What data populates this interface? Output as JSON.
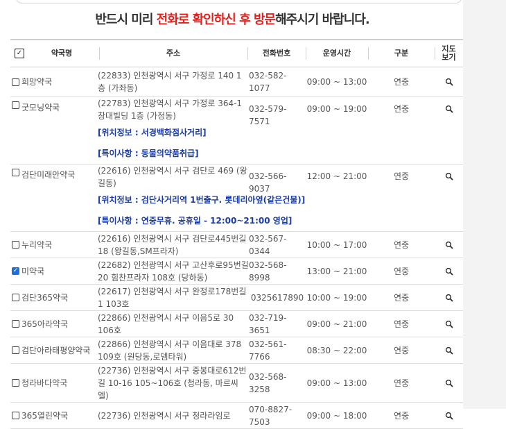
{
  "notice": {
    "part1": "반드시 미리 ",
    "part2": "전화로 확인하신 후 방문",
    "part3": "해주시기 바랍니다."
  },
  "table": {
    "header_checked": true,
    "columns": {
      "name": "약국명",
      "address": "주소",
      "phone": "전화번호",
      "hours": "운영시간",
      "type": "구분",
      "map": "지도\n보기"
    },
    "rows": [
      {
        "name": "희망약국",
        "checked": false,
        "address": "(22833) 인천광역시 서구 가정로 140 1층 (가좌동)",
        "phone": "032-582-1077",
        "hours": "09:00 ~ 13:00",
        "type": "연중"
      },
      {
        "name": "굿모닝약국",
        "checked": false,
        "address": "(22783) 인천광역시 서구 가정로 364-1 창대빌딩 1층 (가정동)",
        "phone": "032-579-7571",
        "hours": "09:00 ~ 19:00",
        "type": "연중",
        "location": "[위치정보 : 서경백화점사거리]",
        "note": "[특이사항 : 동물의약품취급]"
      },
      {
        "name": "검단미래안약국",
        "checked": false,
        "address": "(22616) 인천광역시 서구 검단로 469 (왕길동)",
        "phone": "032-566-9037",
        "hours": "12:00 ~ 21:00",
        "type": "연중",
        "location": "[위치정보 : 검단사거리역 1번출구. 롯데리아옆(같은건물)]",
        "note": "[특이사항 : 연중무휴. 공휴일 - 12:00~21:00 영업]"
      },
      {
        "name": "누리약국",
        "checked": false,
        "address": "(22616) 인천광역시 서구 검단로445번길 18 (왕길동,SM프라자)",
        "phone": "032-567-0344",
        "hours": "10:00 ~ 17:00",
        "type": "연중"
      },
      {
        "name": "미약국",
        "checked": true,
        "address": "(22682) 인천광역시 서구 고산후로95번길 20 힘찬프라자 108호 (당하동)",
        "phone": "032-568-8998",
        "hours": "13:00 ~ 21:00",
        "type": "연중"
      },
      {
        "name": "검단365약국",
        "checked": false,
        "address": "(22617) 인천광역시 서구 완정로178번길 1 103호",
        "phone": "0325617890",
        "hours": "10:00 ~ 19:00",
        "type": "연중"
      },
      {
        "name": "365아라약국",
        "checked": false,
        "address": "(22866) 인천광역시 서구 이음5로 30 106호",
        "phone": "032-719-3651",
        "hours": "09:00 ~ 21:00",
        "type": "연중"
      },
      {
        "name": "검단아라태평양약국",
        "checked": false,
        "address": "(22866) 인천광역시 서구 이음대로 378 109호 (원당동,로뎀타워)",
        "phone": "032-561-7766",
        "hours": "08:30 ~ 22:00",
        "type": "연중"
      },
      {
        "name": "청라바다약국",
        "checked": false,
        "address": "(22736) 인천광역시 서구 중봉대로612번길 10-16 105~106호 (청라동, 마르씨엘)",
        "phone": "032-568-3258",
        "hours": "09:00 ~ 13:00",
        "type": "연중"
      },
      {
        "name": "365열린약국",
        "checked": false,
        "address": "(22736) 인천광역시 서구 청라라임로",
        "phone": "070-8827-7503",
        "hours": "09:00 ~ 18:00",
        "type": "연중"
      }
    ]
  }
}
